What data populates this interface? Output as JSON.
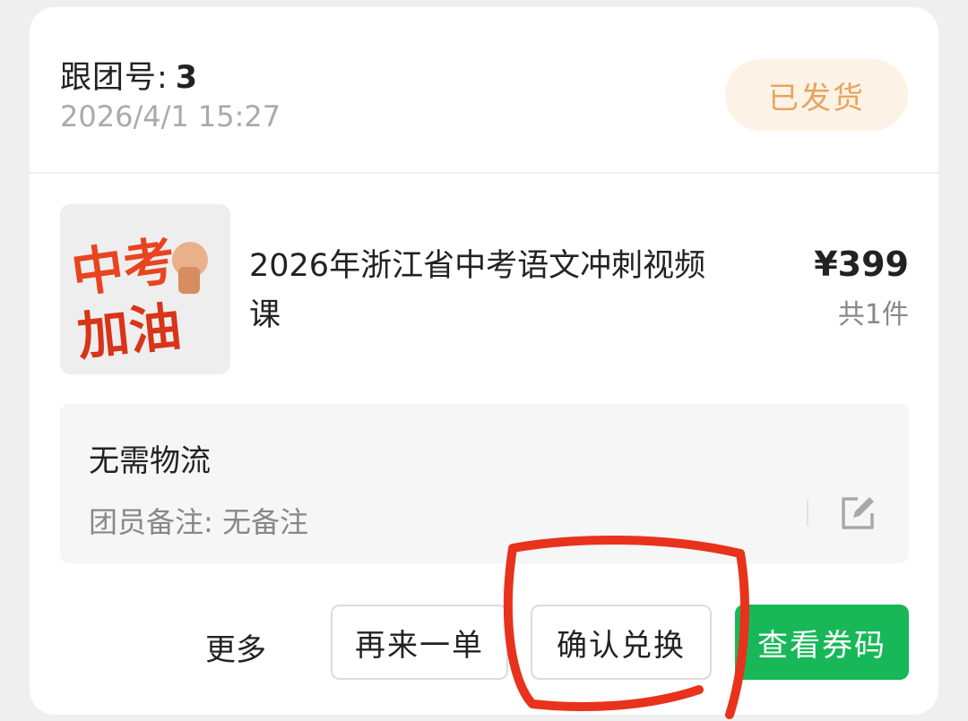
{
  "order": {
    "group_label": "跟团号:",
    "group_number": "3",
    "timestamp": "2026/4/1 15:27",
    "status": "已发货"
  },
  "product": {
    "image_text": "中考加油",
    "title": "2026年浙江省中考语文冲刺视频课",
    "price": "¥399",
    "quantity": "共1件"
  },
  "delivery": {
    "logistics": "无需物流",
    "note": "团员备注: 无备注"
  },
  "actions": {
    "more": "更多",
    "reorder": "再来一单",
    "confirm": "确认兑换",
    "view_code": "查看券码"
  },
  "colors": {
    "primary": "#18b858",
    "status_text": "#e6a560",
    "status_bg": "#fdf2e6",
    "annotation": "#e8321c"
  }
}
